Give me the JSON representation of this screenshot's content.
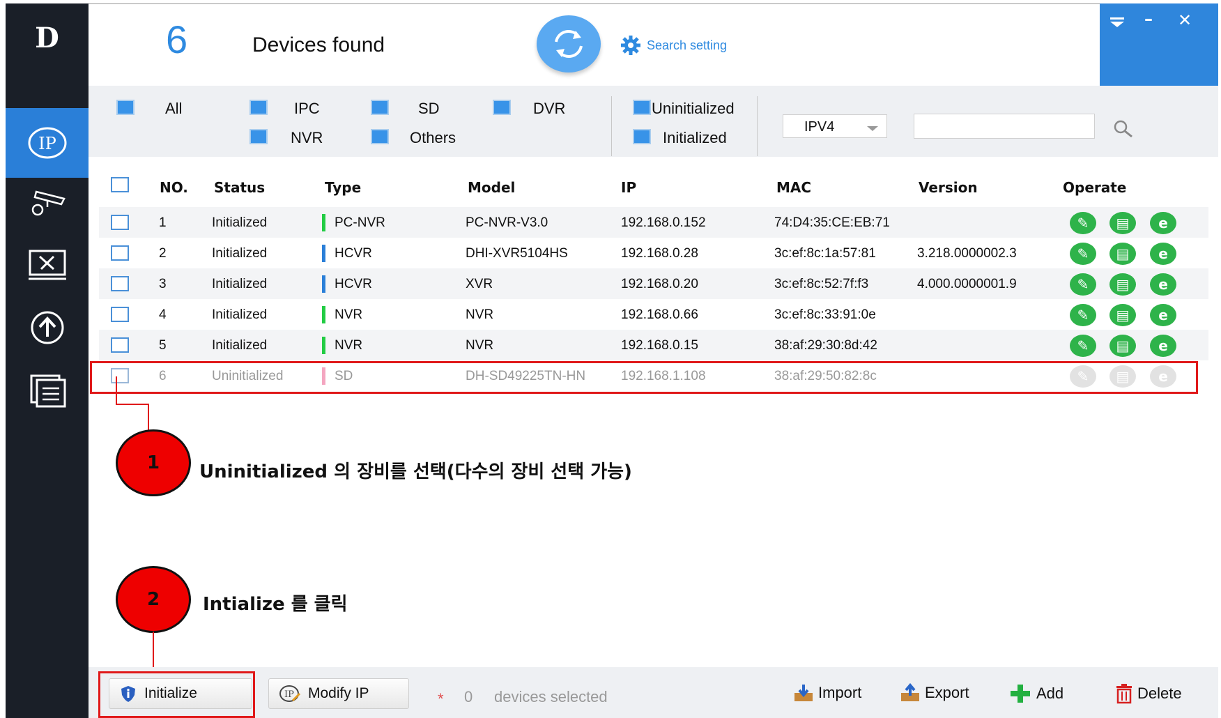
{
  "sidebar": {
    "logo": "D",
    "items": [
      {
        "name": "ip-tool-icon",
        "label": "IP"
      },
      {
        "name": "camera-settings-icon",
        "label": ""
      },
      {
        "name": "system-tools-icon",
        "label": ""
      },
      {
        "name": "upgrade-icon",
        "label": ""
      },
      {
        "name": "documents-icon",
        "label": ""
      }
    ]
  },
  "header": {
    "count": "6",
    "found_label": "Devices found",
    "search_setting": "Search setting"
  },
  "filters": {
    "all": "All",
    "ipc": "IPC",
    "sd": "SD",
    "dvr": "DVR",
    "nvr": "NVR",
    "others": "Others",
    "uninitialized": "Uninitialized",
    "initialized": "Initialized",
    "ip_version": "IPV4",
    "search_placeholder": ""
  },
  "table": {
    "headers": {
      "no": "NO.",
      "status": "Status",
      "type": "Type",
      "model": "Model",
      "ip": "IP",
      "mac": "MAC",
      "version": "Version",
      "operate": "Operate"
    },
    "rows": [
      {
        "no": "1",
        "status": "Initialized",
        "type": "PC-NVR",
        "model": "PC-NVR-V3.0",
        "ip": "192.168.0.152",
        "mac": "74:D4:35:CE:EB:71",
        "version": ""
      },
      {
        "no": "2",
        "status": "Initialized",
        "type": "HCVR",
        "model": "DHI-XVR5104HS",
        "ip": "192.168.0.28",
        "mac": "3c:ef:8c:1a:57:81",
        "version": "3.218.0000002.3"
      },
      {
        "no": "3",
        "status": "Initialized",
        "type": "HCVR",
        "model": "XVR",
        "ip": "192.168.0.20",
        "mac": "3c:ef:8c:52:7f:f3",
        "version": "4.000.0000001.9"
      },
      {
        "no": "4",
        "status": "Initialized",
        "type": "NVR",
        "model": "NVR",
        "ip": "192.168.0.66",
        "mac": "3c:ef:8c:33:91:0e",
        "version": ""
      },
      {
        "no": "5",
        "status": "Initialized",
        "type": "NVR",
        "model": "NVR",
        "ip": "192.168.0.15",
        "mac": "38:af:29:30:8d:42",
        "version": ""
      },
      {
        "no": "6",
        "status": "Uninitialized",
        "type": "SD",
        "model": "DH-SD49225TN-HN",
        "ip": "192.168.1.108",
        "mac": "38:af:29:50:82:8c",
        "version": ""
      }
    ],
    "type_colors": {
      "PC-NVR": "#22cc44",
      "HCVR": "#2a7fd8",
      "NVR": "#22cc44",
      "SD": "#f4a6c0"
    }
  },
  "annotations": {
    "step1_number": "1",
    "step1_text": "Uninitialized 의 장비를 선택(다수의 장비 선택 가능)",
    "step2_number": "2",
    "step2_text": "Intialize 를 클릭"
  },
  "toolbar": {
    "initialize": "Initialize",
    "modify_ip": "Modify IP",
    "star": "*",
    "selected_count": "0",
    "selected_text": "devices selected",
    "import": "Import",
    "export": "Export",
    "add": "Add",
    "delete": "Delete"
  },
  "colors": {
    "accent": "#2e8ae0",
    "sidebar_bg": "#1a1f28",
    "active_green": "#2eb34a",
    "annotation_red": "#e0191a"
  }
}
